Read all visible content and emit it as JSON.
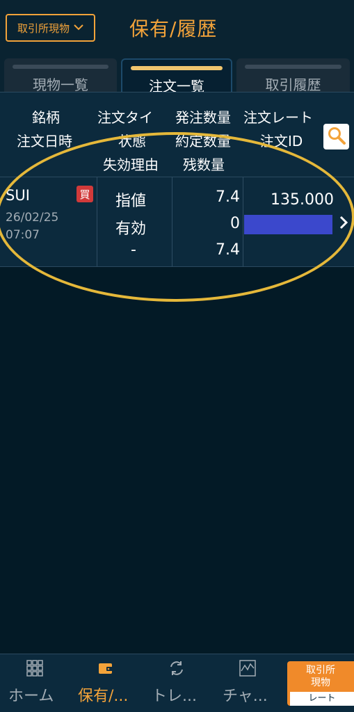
{
  "header": {
    "market_button_label": "取引所現物",
    "title": "保有/履歴"
  },
  "tabs": [
    {
      "label": "現物一覧",
      "active": false
    },
    {
      "label": "注文一覧",
      "active": true
    },
    {
      "label": "取引履歴",
      "active": false
    }
  ],
  "column_headers": {
    "symbol": "銘柄",
    "order_type": "注文タイ",
    "order_qty": "発注数量",
    "order_rate": "注文レート",
    "order_datetime": "注文日時",
    "status": "状態",
    "filled_qty": "約定数量",
    "order_id": "注文ID",
    "invalid_reason": "失効理由",
    "remaining_qty": "残数量"
  },
  "orders": [
    {
      "symbol": "SUI",
      "side": "買",
      "date": "26/02/25",
      "time": "07:07",
      "order_type": "指値",
      "status": "有効",
      "invalid_reason": "-",
      "order_qty": "7.4",
      "filled_qty": "0",
      "remaining_qty": "7.4",
      "rate": "135.000"
    }
  ],
  "bottom_nav": [
    {
      "label": "ホーム",
      "icon": "grid-icon"
    },
    {
      "label": "保有/...",
      "icon": "wallet-icon",
      "active": true
    },
    {
      "label": "トレ...",
      "icon": "refresh-icon"
    },
    {
      "label": "チャ...",
      "icon": "chart-icon"
    }
  ],
  "rate_button": {
    "top_label": "取引所\n現物",
    "bottom_label": "レート"
  },
  "colors": {
    "accent": "#f3a33a",
    "background": "#031a26",
    "panel": "#0c2a3d",
    "buy_badge": "#d13a3a",
    "rate_bar": "#3b48cc",
    "highlight_ellipse": "#e5b83a"
  }
}
